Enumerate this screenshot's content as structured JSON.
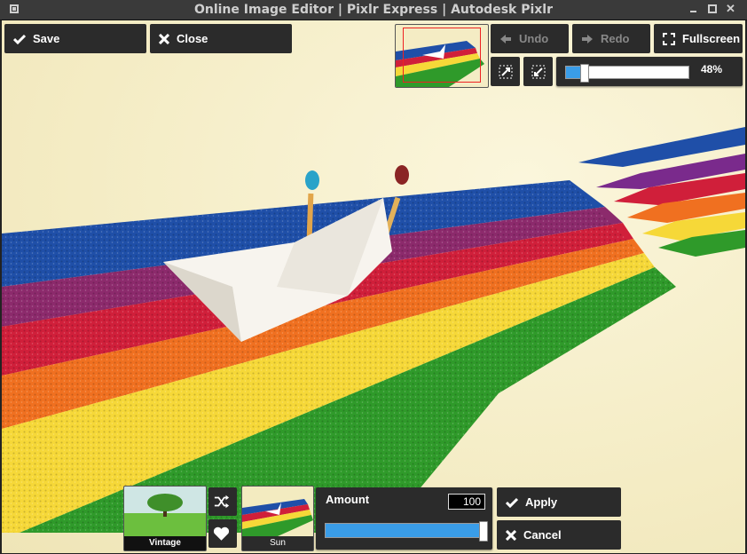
{
  "window": {
    "title": "Online Image Editor | Pixlr Express | Autodesk Pixlr"
  },
  "toolbar": {
    "save_label": "Save",
    "close_label": "Close",
    "undo_label": "Undo",
    "redo_label": "Redo",
    "fullscreen_label": "Fullscreen",
    "zoom_text": "48%",
    "zoom_level": 0.48
  },
  "effects": {
    "current_effect": "Vintage",
    "selected_effect": "Sun",
    "amount_label": "Amount",
    "amount_value": "100",
    "amount_fraction": 1.0,
    "apply_label": "Apply",
    "cancel_label": "Cancel"
  },
  "colors": {
    "panel": "#2b2b2b",
    "accent": "#3a9de8",
    "title_bg": "#3a3a3a"
  }
}
